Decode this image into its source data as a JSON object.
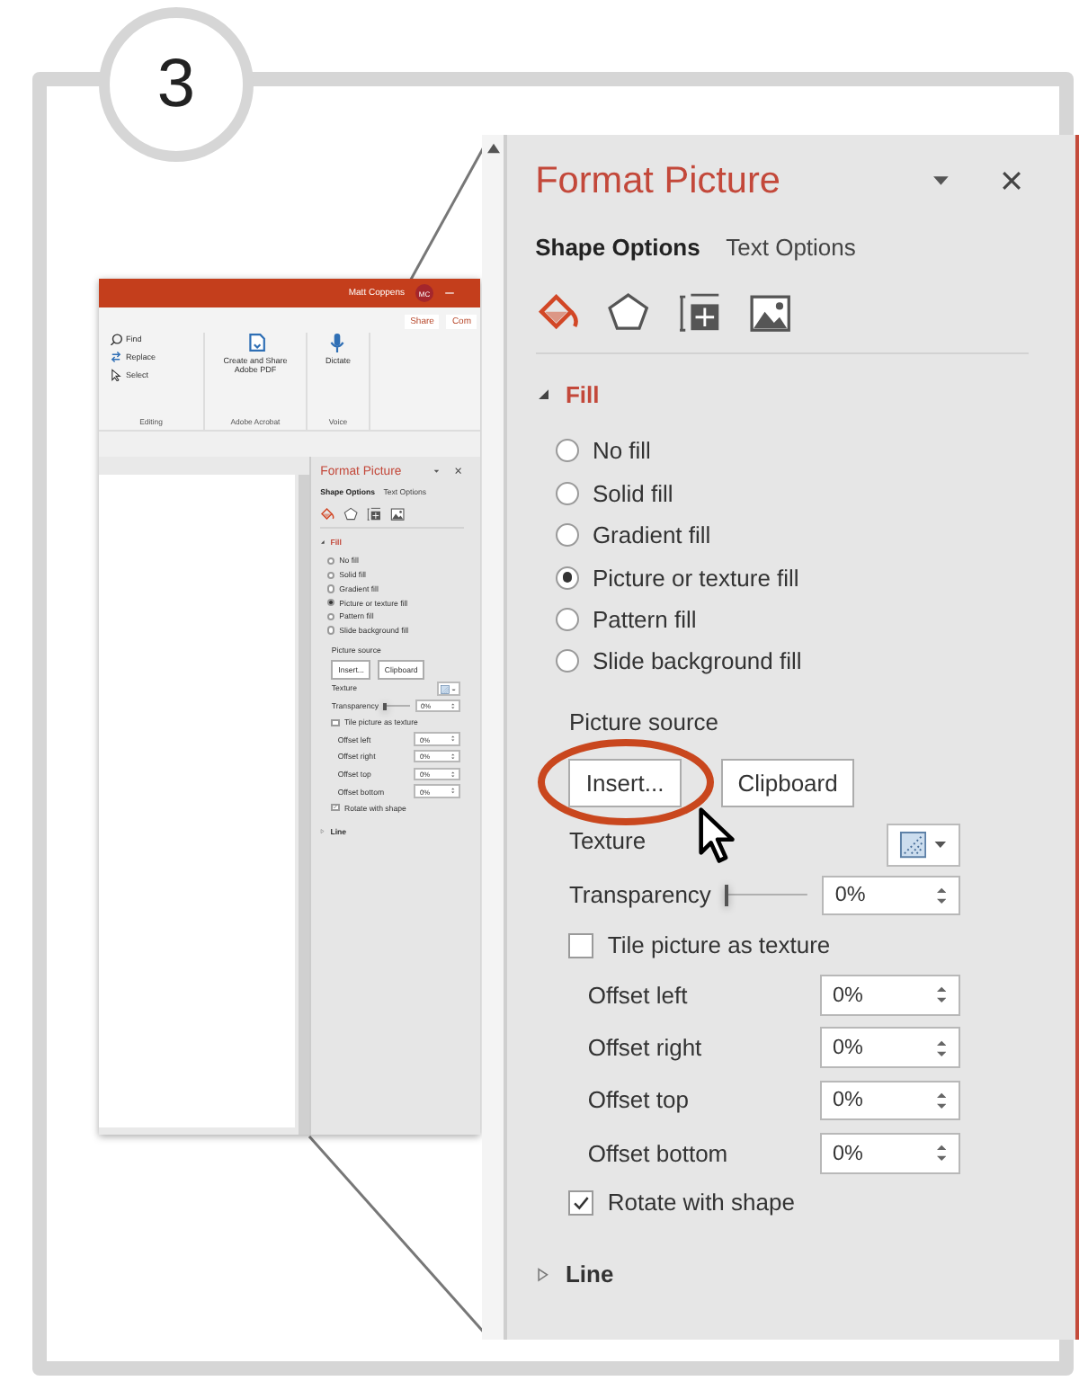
{
  "step_badge": "3",
  "thumbnail": {
    "title_bar": {
      "user": "Matt Coppens",
      "avatar": "MC"
    },
    "ribbon": {
      "commands": [
        "Share",
        "Com"
      ],
      "groups": [
        {
          "items": [
            "Find",
            "Replace",
            "Select"
          ],
          "label": "Editing"
        },
        {
          "items": [
            "Create and Share Adobe PDF"
          ],
          "label": "Adobe Acrobat"
        },
        {
          "items": [
            "Dictate"
          ],
          "label": "Voice"
        }
      ]
    },
    "pane": {
      "title": "Format Picture",
      "tabs": [
        {
          "label": "Shape Options",
          "selected": true
        },
        {
          "label": "Text Options",
          "selected": false
        }
      ],
      "icon_tabs": [
        {
          "kind": "fill",
          "selected": true
        },
        {
          "kind": "effects",
          "selected": false
        },
        {
          "kind": "size",
          "selected": false
        },
        {
          "kind": "picture",
          "selected": false
        }
      ],
      "fill": {
        "label": "Fill",
        "expanded": true,
        "options": [
          {
            "label": "No fill",
            "selected": false
          },
          {
            "label": "Solid fill",
            "selected": false
          },
          {
            "label": "Gradient fill",
            "selected": false
          },
          {
            "label": "Picture or texture fill",
            "selected": true
          },
          {
            "label": "Pattern fill",
            "selected": false
          },
          {
            "label": "Slide background fill",
            "selected": false
          }
        ],
        "picture_source": "Picture source",
        "buttons": [
          "Insert...",
          "Clipboard"
        ],
        "texture": "Texture",
        "transparency": {
          "label": "Transparency",
          "level": 0,
          "value": "0%"
        },
        "tile": {
          "label": "Tile picture as texture",
          "checked": false
        },
        "offsets": [
          {
            "label": "Offset left",
            "value": "0%"
          },
          {
            "label": "Offset right",
            "value": "0%"
          },
          {
            "label": "Offset top",
            "value": "0%"
          },
          {
            "label": "Offset bottom",
            "value": "0%"
          }
        ],
        "rotate": {
          "label": "Rotate with shape",
          "checked": true
        }
      },
      "line": {
        "label": "Line",
        "expanded": false
      }
    }
  },
  "pane": {
    "title": "Format Picture",
    "tabs": [
      {
        "label": "Shape Options",
        "selected": true
      },
      {
        "label": "Text Options",
        "selected": false
      }
    ],
    "icon_tabs": [
      {
        "kind": "fill",
        "selected": true
      },
      {
        "kind": "effects",
        "selected": false
      },
      {
        "kind": "size",
        "selected": false
      },
      {
        "kind": "picture",
        "selected": false
      }
    ],
    "fill": {
      "label": "Fill",
      "expanded": true,
      "options": [
        {
          "label": "No fill",
          "selected": false
        },
        {
          "label": "Solid fill",
          "selected": false
        },
        {
          "label": "Gradient fill",
          "selected": false
        },
        {
          "label": "Picture or texture fill",
          "selected": true
        },
        {
          "label": "Pattern fill",
          "selected": false
        },
        {
          "label": "Slide background fill",
          "selected": false
        }
      ],
      "picture_source": "Picture source",
      "buttons": [
        "Insert...",
        "Clipboard"
      ],
      "texture": "Texture",
      "transparency": {
        "label": "Transparency",
        "level": 0,
        "value": "0%"
      },
      "tile": {
        "label": "Tile picture as texture",
        "checked": false
      },
      "offsets": [
        {
          "label": "Offset left",
          "value": "0%"
        },
        {
          "label": "Offset right",
          "value": "0%"
        },
        {
          "label": "Offset top",
          "value": "0%"
        },
        {
          "label": "Offset bottom",
          "value": "0%"
        }
      ],
      "rotate": {
        "label": "Rotate with shape",
        "checked": true
      }
    },
    "line": {
      "label": "Line",
      "expanded": false
    }
  }
}
